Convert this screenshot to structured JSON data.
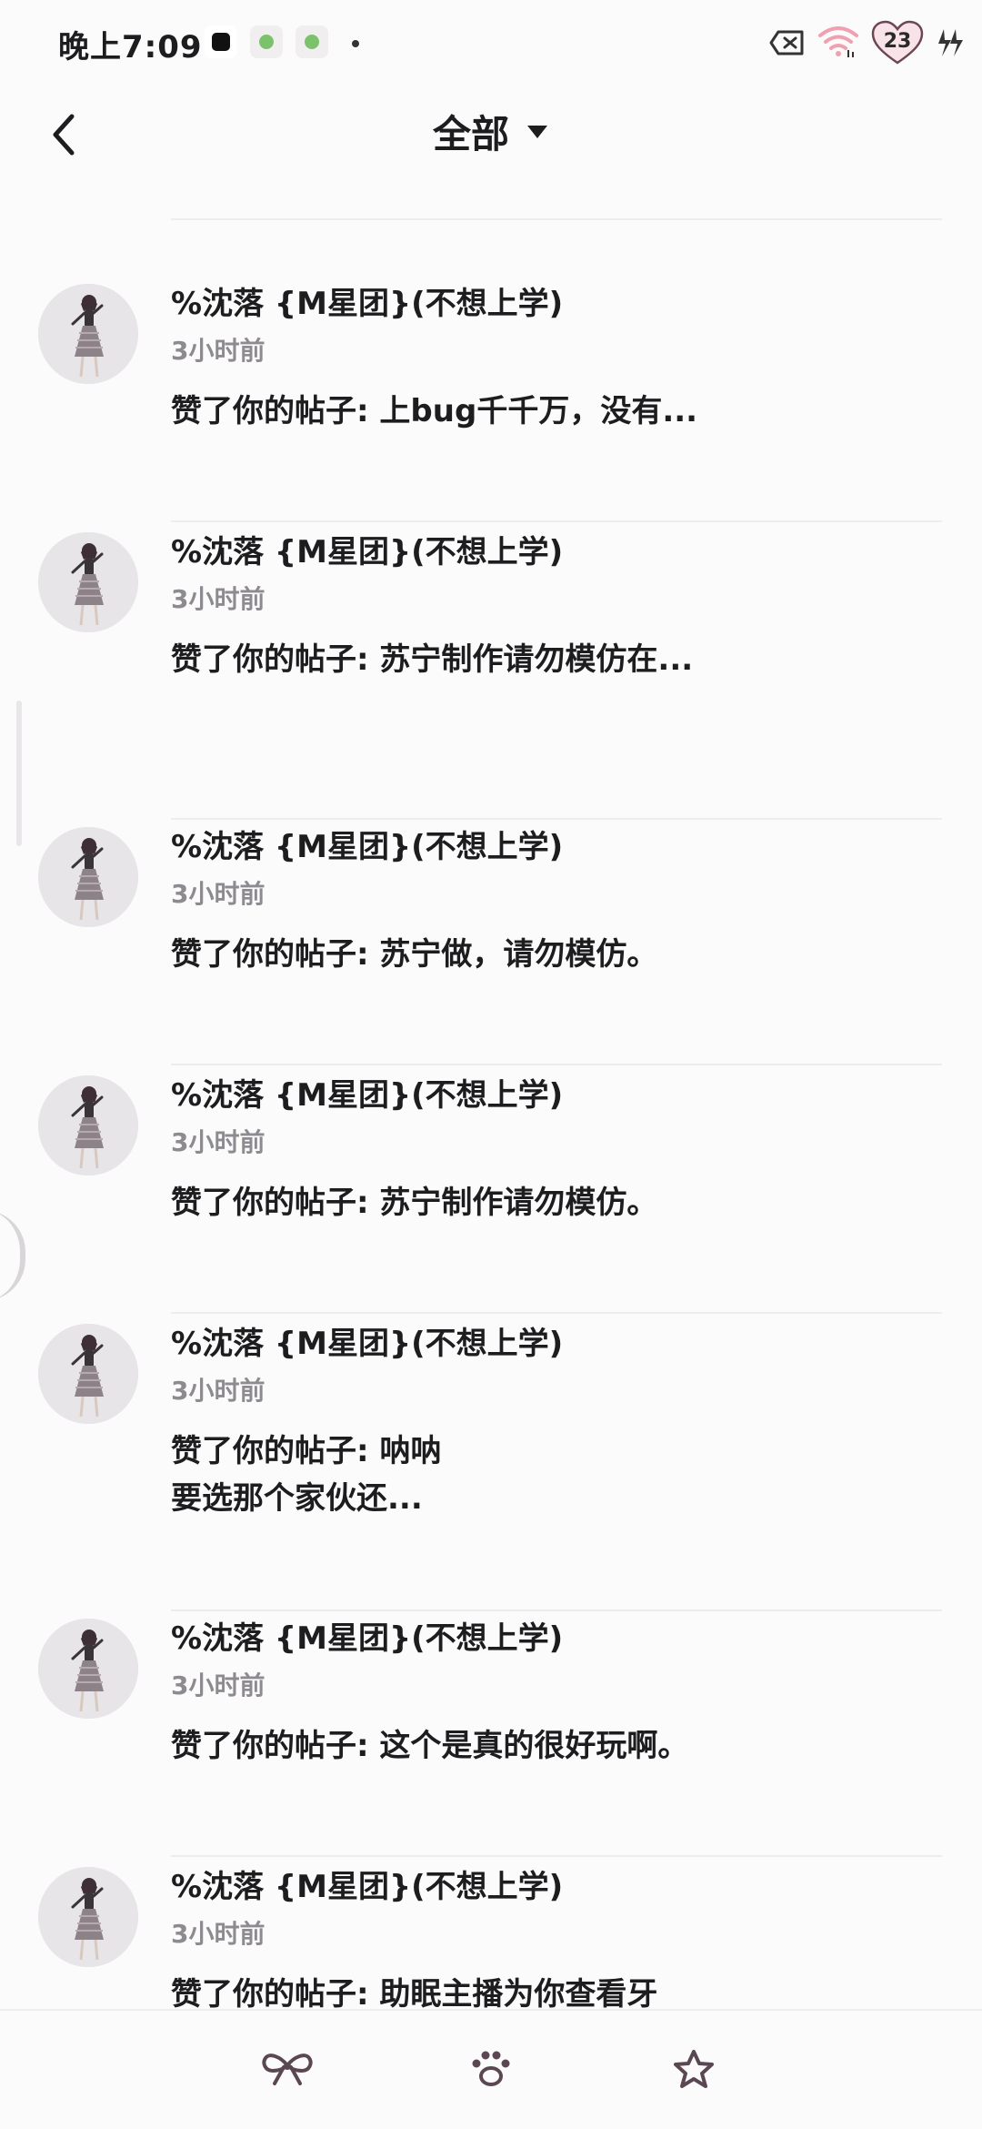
{
  "status_bar": {
    "time": "晚上7:09",
    "battery": "23",
    "apps": [
      "tiktok-icon",
      "wechat-icon",
      "wechat-icon"
    ]
  },
  "header": {
    "title": "全部",
    "back_icon": "chevron-left-icon",
    "dropdown_icon": "caret-down-icon"
  },
  "notifications": [
    {
      "user": "%沈落 {M星团}(不想上学)",
      "time": "3小时前",
      "message": "赞了你的帖子: 上bug千千万，没有..."
    },
    {
      "user": "%沈落 {M星团}(不想上学)",
      "time": "3小时前",
      "message": "赞了你的帖子: 苏宁制作请勿模仿在..."
    },
    {
      "user": "%沈落 {M星团}(不想上学)",
      "time": "3小时前",
      "message": "赞了你的帖子: 苏宁做，请勿模仿。"
    },
    {
      "user": "%沈落 {M星团}(不想上学)",
      "time": "3小时前",
      "message": "赞了你的帖子: 苏宁制作请勿模仿。"
    },
    {
      "user": "%沈落 {M星团}(不想上学)",
      "time": "3小时前",
      "message": "赞了你的帖子: 呐呐\n要选那个家伙还..."
    },
    {
      "user": "%沈落 {M星团}(不想上学)",
      "time": "3小时前",
      "message": "赞了你的帖子: 这个是真的很好玩啊。"
    },
    {
      "user": "%沈落 {M星团}(不想上学)",
      "time": "3小时前",
      "message": "赞了你的帖子: 助眠主播为你查看牙齿..."
    }
  ],
  "bottom_nav": {
    "items": [
      "bow-icon",
      "paw-icon",
      "star-icon"
    ]
  },
  "colors": {
    "background": "#fcfbfc",
    "text": "#1d1d1f",
    "secondary_text": "#8e8b90",
    "icon_accent": "#5b4752"
  }
}
